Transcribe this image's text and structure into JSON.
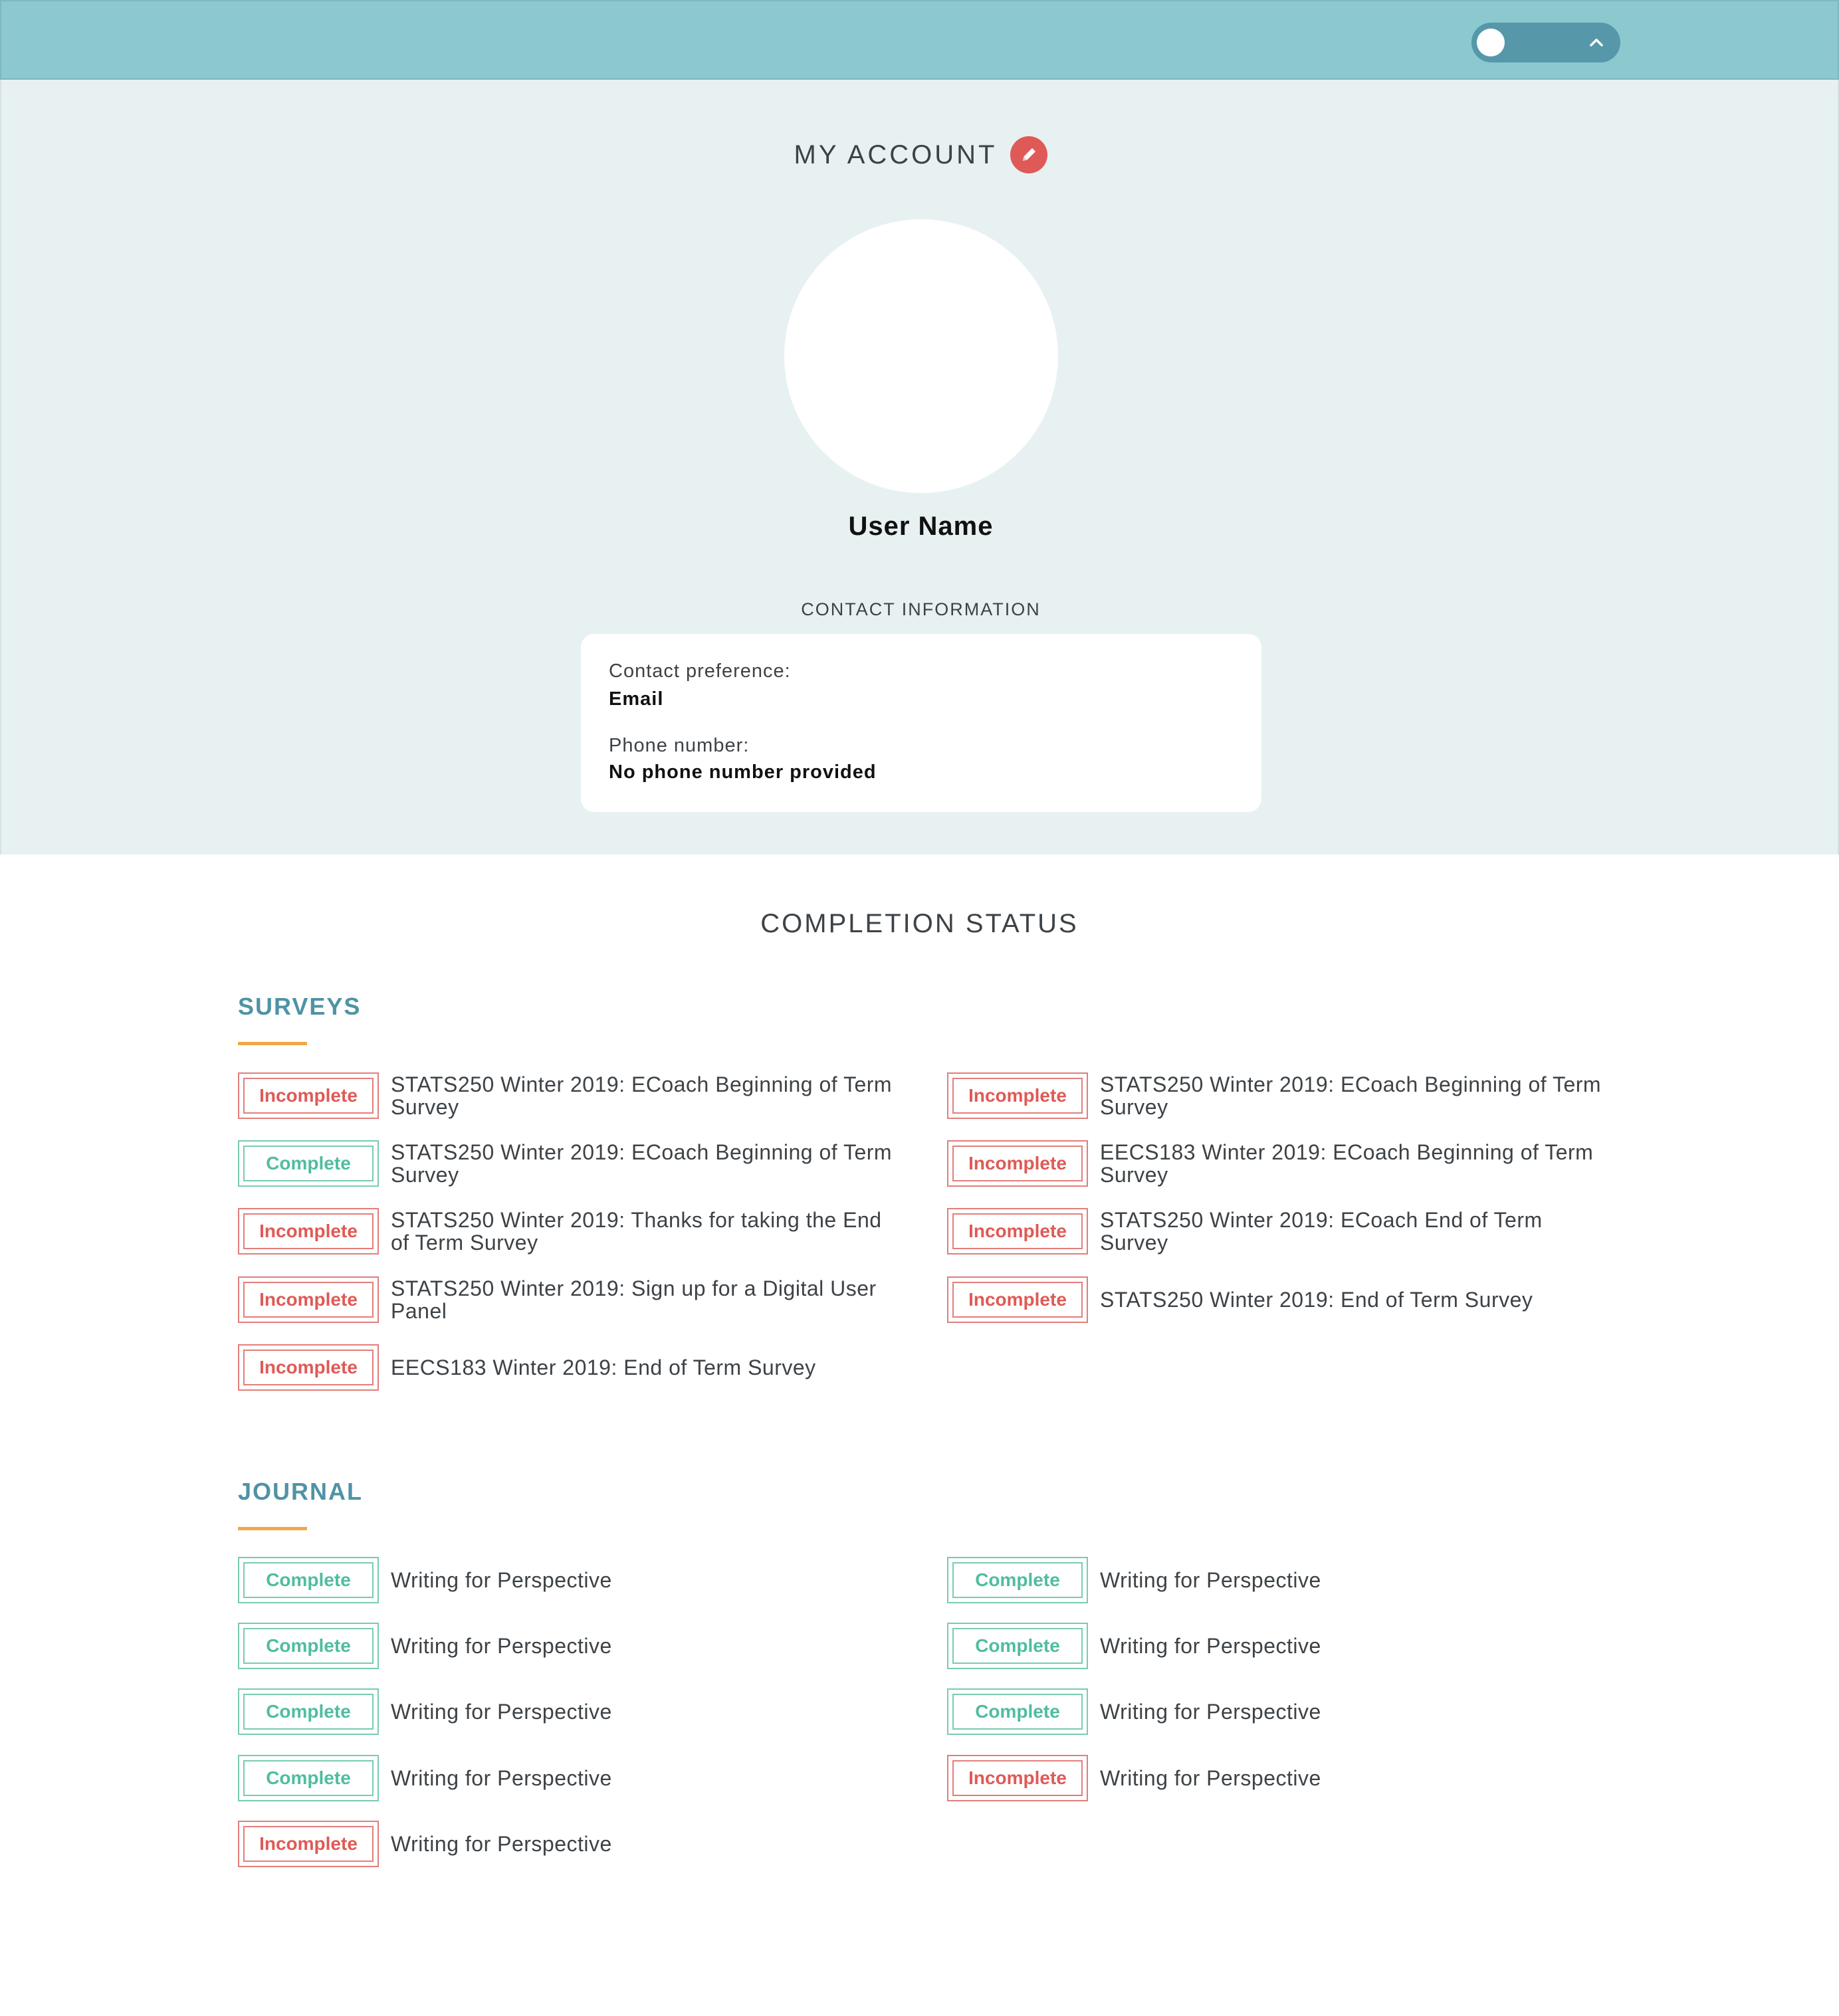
{
  "header": {
    "toggle_state": "off"
  },
  "account": {
    "title": "MY ACCOUNT",
    "user_name": "User Name",
    "contact_heading": "CONTACT INFORMATION",
    "contact_pref_label": "Contact preference:",
    "contact_pref_value": "Email",
    "phone_label": "Phone number:",
    "phone_value": "No phone number provided"
  },
  "completion": {
    "title": "COMPLETION STATUS",
    "surveys": {
      "heading": "SURVEYS",
      "items": [
        {
          "status": "Incomplete",
          "title": "STATS250 Winter 2019: ECoach Beginning of Term Survey"
        },
        {
          "status": "Complete",
          "title": "STATS250 Winter 2019: ECoach Beginning of Term Survey"
        },
        {
          "status": "Incomplete",
          "title": "STATS250 Winter 2019: Thanks for taking the End of Term Survey"
        },
        {
          "status": "Incomplete",
          "title": "STATS250 Winter 2019: Sign up for a Digital User Panel"
        },
        {
          "status": "Incomplete",
          "title": "EECS183 Winter 2019: End of Term Survey"
        },
        {
          "status": "Incomplete",
          "title": "STATS250 Winter 2019: ECoach Beginning of Term Survey"
        },
        {
          "status": "Incomplete",
          "title": "EECS183 Winter 2019: ECoach Beginning of Term Survey"
        },
        {
          "status": "Incomplete",
          "title": "STATS250 Winter 2019: ECoach End of Term Survey"
        },
        {
          "status": "Incomplete",
          "title": "STATS250 Winter 2019: End of Term Survey"
        }
      ]
    },
    "journal": {
      "heading": "JOURNAL",
      "items": [
        {
          "status": "Complete",
          "title": "Writing for Perspective"
        },
        {
          "status": "Complete",
          "title": "Writing for Perspective"
        },
        {
          "status": "Complete",
          "title": "Writing for Perspective"
        },
        {
          "status": "Complete",
          "title": "Writing for Perspective"
        },
        {
          "status": "Incomplete",
          "title": "Writing for Perspective"
        },
        {
          "status": "Complete",
          "title": "Writing for Perspective"
        },
        {
          "status": "Complete",
          "title": "Writing for Perspective"
        },
        {
          "status": "Complete",
          "title": "Writing for Perspective"
        },
        {
          "status": "Incomplete",
          "title": "Writing for Perspective"
        }
      ]
    }
  }
}
